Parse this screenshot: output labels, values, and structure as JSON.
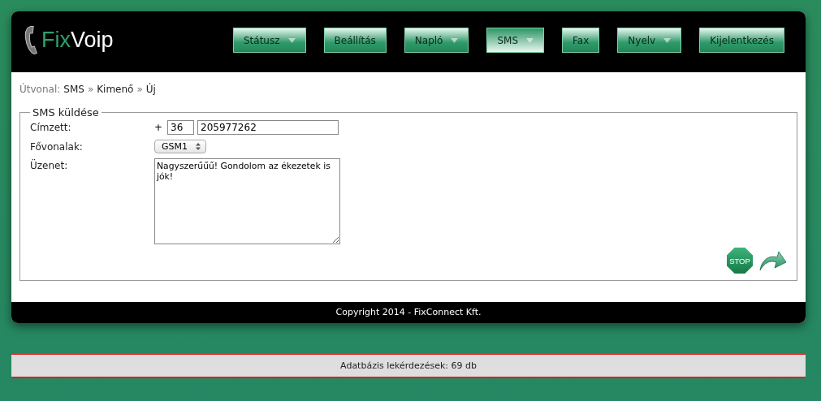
{
  "logo": {
    "part_1": "Fix",
    "part_2": "Voip"
  },
  "nav": [
    {
      "label": "Státusz",
      "dropdown": true,
      "selected": false
    },
    {
      "label": "Beállítás",
      "dropdown": false,
      "selected": false
    },
    {
      "label": "Napló",
      "dropdown": true,
      "selected": false
    },
    {
      "label": "SMS",
      "dropdown": true,
      "selected": true
    },
    {
      "label": "Fax",
      "dropdown": false,
      "selected": false
    },
    {
      "label": "Nyelv",
      "dropdown": true,
      "selected": false
    },
    {
      "label": "Kijelentkezés",
      "dropdown": false,
      "selected": false
    }
  ],
  "breadcrumb": {
    "label": "Útvonal:",
    "parts": [
      {
        "kind": "link",
        "text": "SMS"
      },
      {
        "kind": "separator",
        "text": "»"
      },
      {
        "kind": "link",
        "text": "Kimenő"
      },
      {
        "kind": "separator",
        "text": "»"
      },
      {
        "kind": "link",
        "text": "Új"
      }
    ]
  },
  "form": {
    "legend": "SMS küldése",
    "rows": [
      {
        "kind": "phone",
        "label": "Címzett:",
        "prefix": "+",
        "country_code": "36",
        "number": "205977262"
      },
      {
        "kind": "select",
        "label": "Fővonalak:",
        "value": "GSM1"
      },
      {
        "kind": "textarea",
        "label": "Üzenet:",
        "value": "Nagyszerűűű! Gondolom az ékezetek is jók!"
      }
    ],
    "actions": {
      "stop": "STOP"
    }
  },
  "footer": "Copyright 2014 - FixConnect Kft.",
  "status_bar": "Adatbázis lekérdezések: 69 db"
}
